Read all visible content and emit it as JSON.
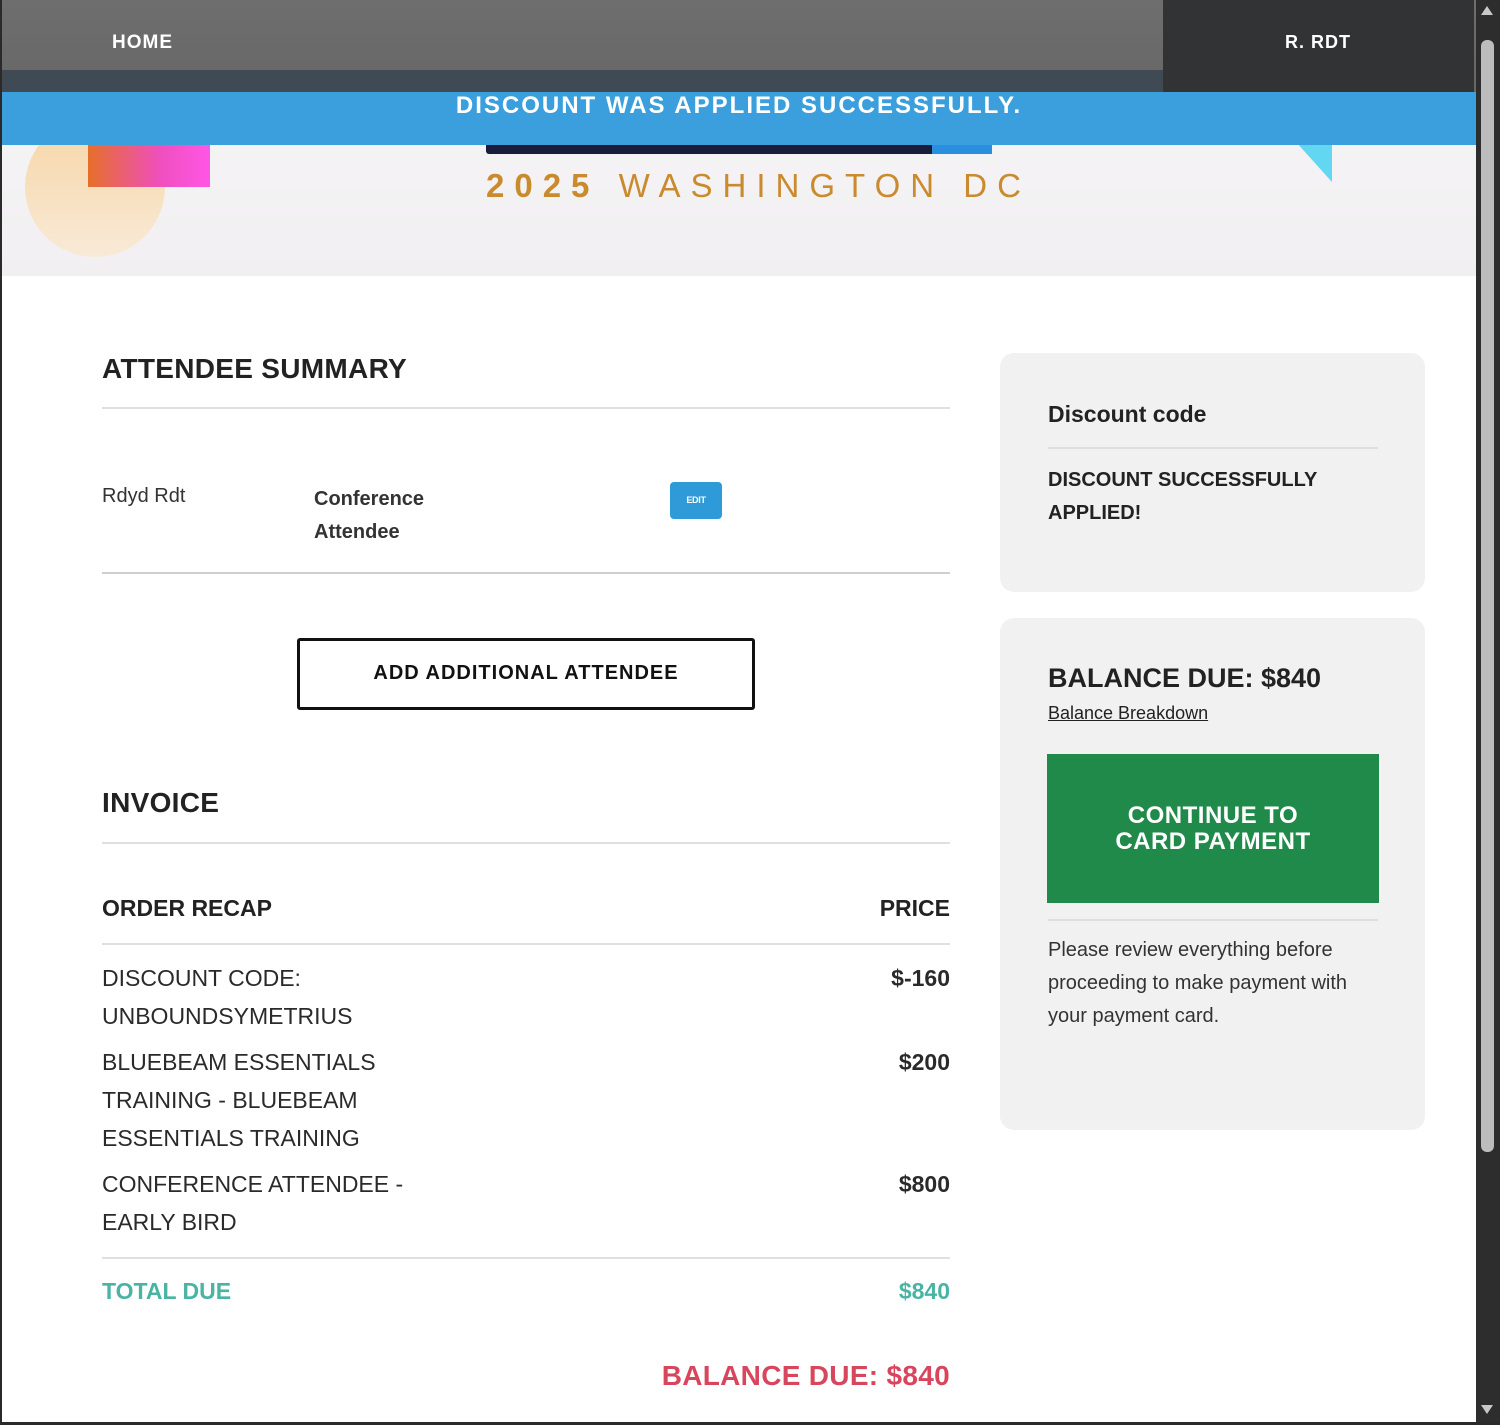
{
  "nav": {
    "home_label": "HOME",
    "user_label": "R. RDT"
  },
  "hero": {
    "year": "2025",
    "location": "WASHINGTON DC"
  },
  "banner": {
    "message": "DISCOUNT WAS APPLIED SUCCESSFULLY."
  },
  "attendee_summary": {
    "title": "ATTENDEE SUMMARY",
    "attendee": {
      "name": "Rdyd Rdt",
      "type": "Conference Attendee",
      "edit_label": "EDIT"
    },
    "add_button_label": "ADD ADDITIONAL ATTENDEE"
  },
  "invoice": {
    "title": "INVOICE",
    "col_order": "ORDER RECAP",
    "col_price": "PRICE",
    "rows": [
      {
        "desc": "DISCOUNT CODE: UNBOUNDSYMETRIUS",
        "price": "$-160"
      },
      {
        "desc": "BLUEBEAM ESSENTIALS TRAINING - BLUEBEAM ESSENTIALS TRAINING",
        "price": "$200"
      },
      {
        "desc": "CONFERENCE ATTENDEE - EARLY BIRD",
        "price": "$800"
      }
    ],
    "total_label": "TOTAL DUE",
    "total_value": "$840",
    "balance_due": "BALANCE DUE: $840"
  },
  "discount_card": {
    "title": "Discount code",
    "message": "DISCOUNT SUCCESSFULLY APPLIED!"
  },
  "balance_card": {
    "title": "BALANCE DUE: $840",
    "breakdown_link": "Balance Breakdown",
    "pay_button": "CONTINUE TO CARD PAYMENT",
    "note": "Please review everything before proceeding to make payment with your payment card."
  },
  "colors": {
    "banner": "#3a9fdc",
    "pay_button": "#1f8a49",
    "total": "#49b3a4",
    "balance_red": "#d8465e",
    "edit_button": "#2f9ad8"
  }
}
